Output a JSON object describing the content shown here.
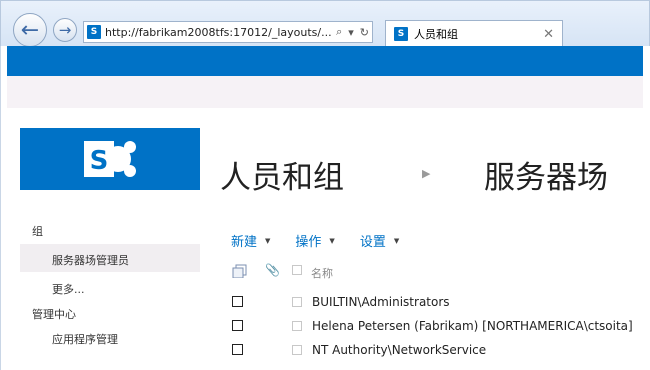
{
  "browser": {
    "url": "http://fabrikam2008tfs:17012/_layouts/...",
    "tab_title": "人员和组",
    "search_glyph": "⌕",
    "refresh_glyph": "↻"
  },
  "site": {
    "page_title": "人员和组",
    "subtitle": "服务器场"
  },
  "leftnav": {
    "group_heading": "组",
    "items": [
      "服务器场管理员",
      "更多..."
    ],
    "section_heading": "管理中心",
    "section_items": [
      "应用程序管理"
    ]
  },
  "toolbar": [
    {
      "label": "新建"
    },
    {
      "label": "操作"
    },
    {
      "label": "设置"
    }
  ],
  "list": {
    "column_name": "名称",
    "rows": [
      {
        "name": "BUILTIN\\Administrators"
      },
      {
        "name": "Helena Petersen (Fabrikam) [NORTHAMERICA\\ctsoita]"
      },
      {
        "name": "NT Authority\\NetworkService"
      }
    ]
  },
  "colors": {
    "accent": "#0072c6",
    "ribbon": "#f6f2f6"
  }
}
